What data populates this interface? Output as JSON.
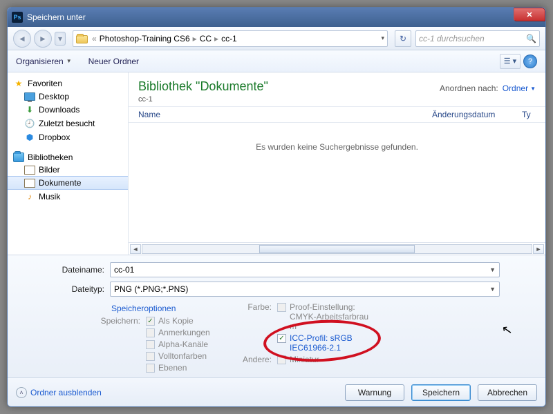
{
  "window": {
    "title": "Speichern unter",
    "app_abbr": "Ps"
  },
  "nav": {
    "breadcrumb": [
      "Photoshop-Training CS6",
      "CC",
      "cc-1"
    ],
    "search_placeholder": "cc-1 durchsuchen"
  },
  "toolbar": {
    "organize": "Organisieren",
    "newfolder": "Neuer Ordner"
  },
  "sidebar": {
    "favorites": {
      "label": "Favoriten",
      "items": [
        "Desktop",
        "Downloads",
        "Zuletzt besucht",
        "Dropbox"
      ]
    },
    "libraries": {
      "label": "Bibliotheken",
      "items": [
        "Bilder",
        "Dokumente",
        "Musik"
      ],
      "selected": "Dokumente"
    }
  },
  "main": {
    "title": "Bibliothek \"Dokumente\"",
    "subtitle": "cc-1",
    "arrange_label": "Anordnen nach:",
    "arrange_value": "Ordner",
    "columns": {
      "name": "Name",
      "modified": "Änderungsdatum",
      "type_short": "Ty"
    },
    "empty_text": "Es wurden keine Suchergebnisse gefunden."
  },
  "file": {
    "name_label": "Dateiname:",
    "name_value": "cc-01",
    "type_label": "Dateityp:",
    "type_value": "PNG (*.PNG;*.PNS)"
  },
  "options": {
    "header": "Speicheroptionen",
    "save_label": "Speichern:",
    "as_copy": "Als Kopie",
    "annotations": "Anmerkungen",
    "alpha": "Alpha-Kanäle",
    "spot": "Volltonfarben",
    "layers": "Ebenen",
    "color_label": "Farbe:",
    "proof": "Proof-Einstellung:",
    "proof2": "CMYK-Arbeitsfarbrau",
    "proof3": "m",
    "icc": "ICC-Profil: sRGB",
    "icc2": "IEC61966-2.1",
    "other_label": "Andere:",
    "thumb": "Miniatur"
  },
  "footer": {
    "hide_folders": "Ordner ausblenden",
    "warning": "Warnung",
    "save": "Speichern",
    "cancel": "Abbrechen"
  }
}
